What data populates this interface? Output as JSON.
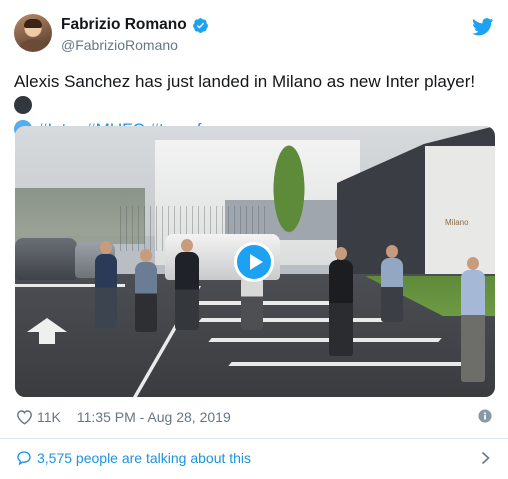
{
  "author": {
    "display_name": "Fabrizio Romano",
    "handle": "@FabrizioRomano",
    "verified": true
  },
  "tweet": {
    "text": "Alexis Sanchez has just landed in Milano as new Inter player!",
    "emoji_1": "black-circle",
    "emoji_2": "blue-circle",
    "hashtags": [
      "#Inter",
      "#MUFC",
      "#transfers"
    ]
  },
  "media": {
    "type": "video",
    "play_icon": "play-icon",
    "wall_sign": "Milano"
  },
  "meta": {
    "likes": "11K",
    "timestamp": "11:35 PM - Aug 28, 2019"
  },
  "conversation": {
    "label": "3,575 people are talking about this"
  },
  "colors": {
    "accent": "#1da1f2",
    "link": "#1b95e0",
    "secondary_text": "#657786",
    "divider": "#e1e8ed"
  },
  "icons": [
    "verified-badge-icon",
    "twitter-bird-icon",
    "heart-icon",
    "info-icon",
    "speech-bubble-icon",
    "chevron-right-icon"
  ]
}
